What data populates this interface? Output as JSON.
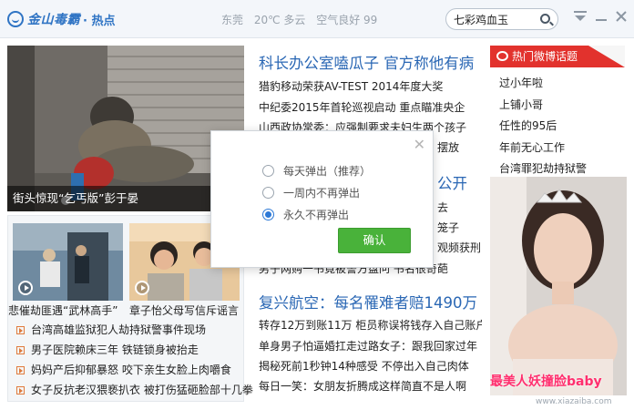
{
  "topbar": {
    "logo": "金山毒霸",
    "logo_sub": "· 热点",
    "weather": [
      "东莞",
      "20℃ 多云",
      "空气良好 99"
    ],
    "search_value": "七彩鸡血玉"
  },
  "hero": {
    "caption": "街头惊现“乞丐版”彭于晏"
  },
  "middle": {
    "headline1": "科长办公室嗑瓜子 官方称他有病",
    "lines1": [
      "猎豹移动荣获AV-TEST 2014年度大奖",
      "中纪委2015年首轮巡视启动 重点瞄准央企",
      "山西政协常委：应强制要求夫妇生两个孩子",
      "摆放"
    ],
    "headline2_tail": "公开",
    "lines2_tails": [
      "去",
      "笼子",
      "观频获刑"
    ],
    "line2_4": "男子网购一书竟被警方盘问 书名很奇葩",
    "headline3": "复兴航空：每名罹难者赔1490万",
    "lines3": [
      "转存12万到账11万 柜员称误将钱存入自己账户",
      "单身男子怕逼婚扛走过路女子：跟我回家过年",
      "揭秘死前1秒钟14种感受 不停出入自己肉体",
      "每日一笑：女朋友折腾成这样简直不是人啊"
    ]
  },
  "thumbs": [
    {
      "caption": "悲催劫匪遇“武林高手”"
    },
    {
      "caption": "章子怡父母写信斥谣言"
    }
  ],
  "small_list": [
    "台湾高雄监狱犯人劫持狱警事件现场",
    "男子医院赖床三年 铁链锁身被抬走",
    "妈妈产后抑郁暴怒 咬下亲生女脸上肉嚼食",
    "女子反抗老汉猥亵扒衣 被打伤猛砸脸部十几拳"
  ],
  "weibo": {
    "title": "热门微博话题",
    "items": [
      "过小年啦",
      "上铺小哥",
      "任性的95后",
      "年前无心工作",
      "台湾罪犯劫持狱警"
    ]
  },
  "girl": {
    "caption": "最美人妖撞脸baby"
  },
  "dialog": {
    "options": [
      "每天弹出（推荐）",
      "一周内不再弹出",
      "永久不再弹出"
    ],
    "selected_index": 2,
    "confirm": "确认"
  },
  "watermark": "www.xiazaiba.com",
  "colors": {
    "brand_blue": "#2f74c4",
    "headline_blue": "#2a67b4",
    "weibo_red": "#e2322d",
    "confirm_green": "#49b23a"
  }
}
